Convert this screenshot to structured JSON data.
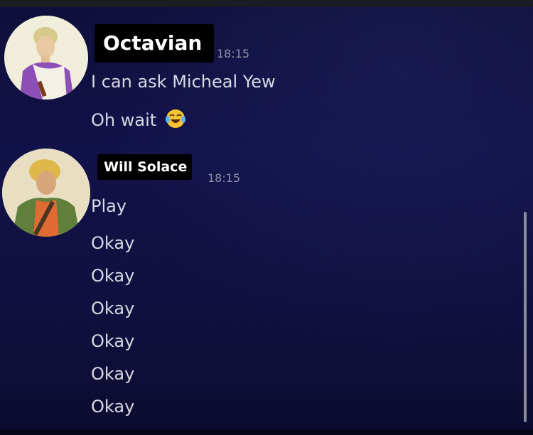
{
  "messages_group_1": {
    "author": "Octavian",
    "time": "18:15",
    "avatar_icon": "octavian-avatar",
    "lines": [
      "I can ask Micheal Yew",
      "Oh wait"
    ],
    "emoji": "laughing-tears-emoji"
  },
  "messages_group_2": {
    "author": "Will Solace",
    "time": "18:15",
    "avatar_icon": "will-solace-avatar",
    "lines": [
      "Play",
      "Okay",
      "Okay",
      "Okay",
      "Okay",
      "Okay",
      "Okay"
    ]
  },
  "colors": {
    "background": "#10103f",
    "name_tag_bg": "#000000",
    "message_text": "#d7d8e2",
    "timestamp_text": "#8e90a6"
  }
}
